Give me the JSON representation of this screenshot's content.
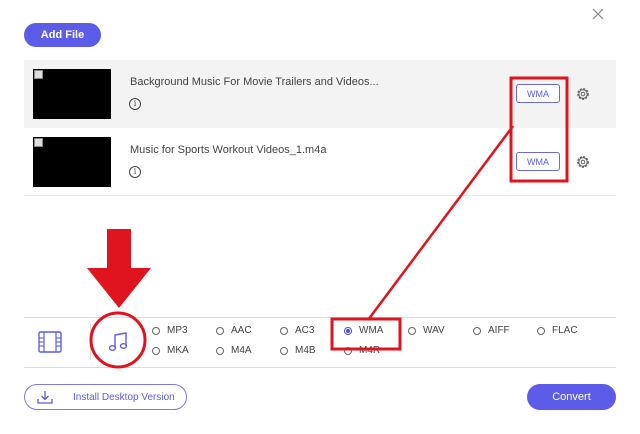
{
  "toolbar": {
    "add_file_label": "Add File"
  },
  "files": [
    {
      "name": "Background Music For Movie Trailers and Videos...",
      "format": "WMA"
    },
    {
      "name": "Music for Sports Workout Videos_1.m4a",
      "format": "WMA"
    }
  ],
  "format_options": {
    "row1": [
      "MP3",
      "AAC",
      "AC3",
      "WMA",
      "WAV",
      "AIFF",
      "FLAC"
    ],
    "row2": [
      "MKA",
      "M4A",
      "M4B",
      "M4R"
    ],
    "selected": "WMA"
  },
  "footer": {
    "install_label": "Install Desktop Version",
    "convert_label": "Convert"
  },
  "colors": {
    "accent": "#5c5ce8",
    "annotation": "#e0141e"
  }
}
